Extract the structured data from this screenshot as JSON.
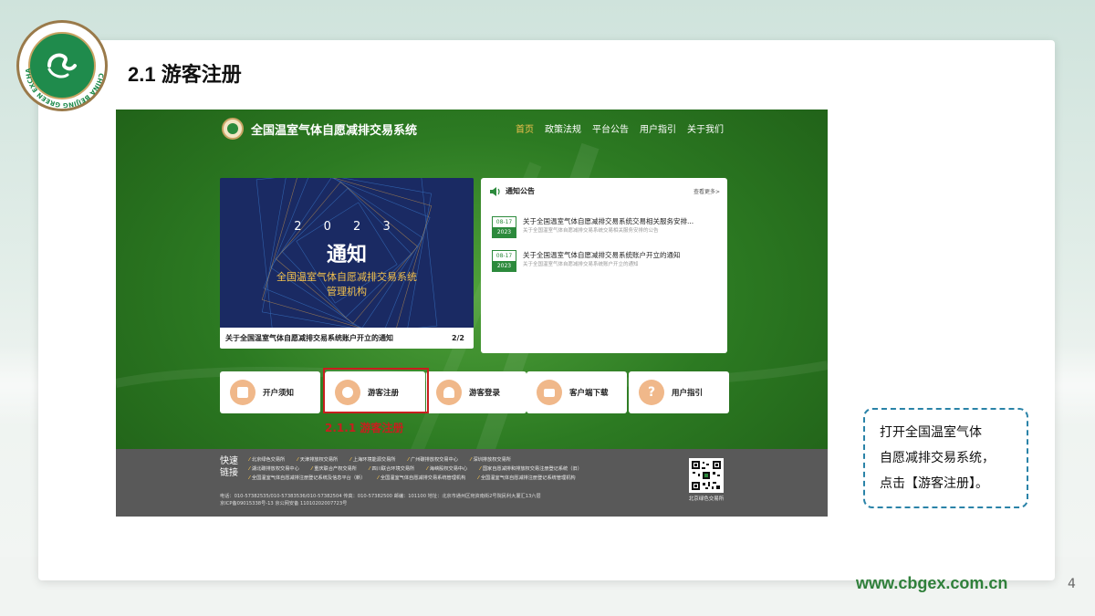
{
  "slide": {
    "title": "2.1 游客注册",
    "logo_text": "CHINA BEIJING GREEN EXCHANGE",
    "logo_cn": "北京绿色交易所",
    "url": "www.cbgex.com.cn",
    "page_number": "4",
    "callout_lines": [
      "打开全国温室气体",
      "自愿减排交易系统，",
      "点击【游客注册】。"
    ]
  },
  "site": {
    "title": "全国温室气体自愿减排交易系统",
    "nav": [
      "首页",
      "政策法规",
      "平台公告",
      "用户指引",
      "关于我们"
    ],
    "active_nav": "首页"
  },
  "banner": {
    "year": "2 0 2 3",
    "heading": "通知",
    "sub1": "全国温室气体自愿减排交易系统",
    "sub2": "管理机构",
    "caption": "关于全国温室气体自愿减排交易系统账户开立的通知",
    "pager": "2/2"
  },
  "notices": {
    "title": "通知公告",
    "more": "查看更多>",
    "items": [
      {
        "month_day": "08-17",
        "year": "2023",
        "title": "关于全国温室气体自愿减排交易系统交易相关服务安排...",
        "summary": "关于全国温室气体自愿减排交易系统交易相关服务安排的公告"
      },
      {
        "month_day": "08-17",
        "year": "2023",
        "title": "关于全国温室气体自愿减排交易系统账户开立的通知",
        "summary": "关于全国温室气体自愿减排交易系统账户开立的通知"
      }
    ]
  },
  "quick": {
    "buttons": [
      "开户须知",
      "游客注册",
      "游客登录",
      "客户端下载",
      "用户指引"
    ],
    "highlight_label": "2.1.1 游客注册"
  },
  "footer": {
    "title": "快速链接",
    "links_row1": [
      "北京绿色交易所",
      "天津排放权交易所",
      "上海环境能源交易所",
      "广州碳排放权交易中心",
      "深圳排放权交易所"
    ],
    "links_row2": [
      "湖北碳排放权交易中心",
      "重庆联合产权交易所",
      "四川联合环境交易所",
      "海峡股权交易中心",
      "国家自愿减排和排放权交易注册登记系统（旧）"
    ],
    "links_row3": [
      "全国温室气体自愿减排注册登记系统及信息平台（新）",
      "全国温室气体自愿减排交易系统管理机构",
      "全国温室气体自愿减排注册登记系统管理机构"
    ],
    "contact": "电话：010-57382535/010-57383536/010-57382504    传真：010-57382500    邮编：101100    地址：北京市通州区宛资南街2号院民利大厦汇13六层",
    "icp": "京ICP备09015338号-13    京公网安备 11010202007723号",
    "qr_label": "北京绿色交易所"
  }
}
